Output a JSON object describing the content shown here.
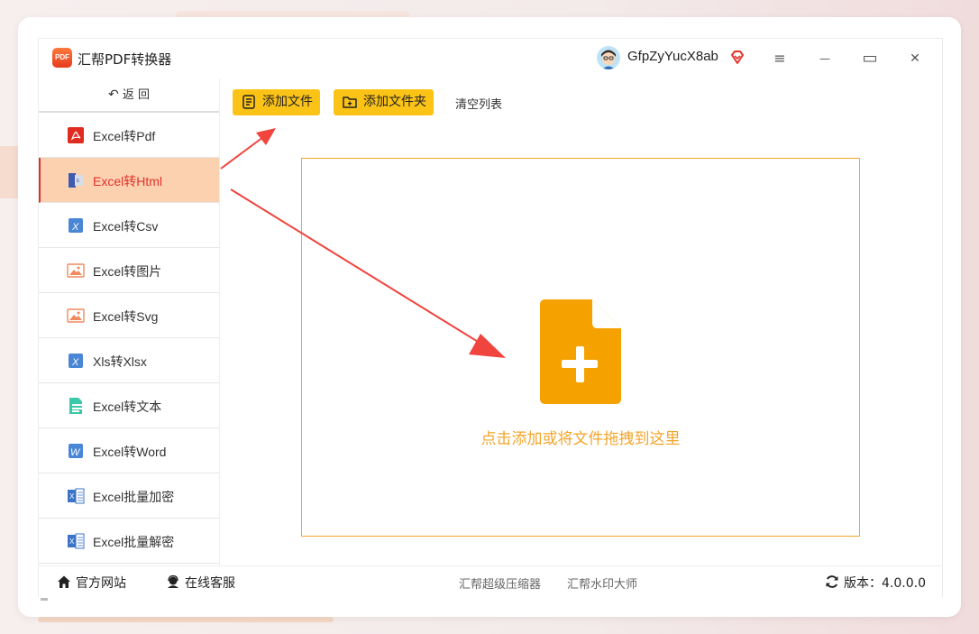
{
  "app": {
    "logo_text": "PDF",
    "title": "汇帮PDF转换器"
  },
  "user": {
    "name": "GfpZyYucX8ab"
  },
  "window_controls": {
    "menu": "≡",
    "minimize": "—",
    "maximize": "▭",
    "close": "✕"
  },
  "sidebar": {
    "back_label": "返 回",
    "items": [
      {
        "label": "Excel转Pdf",
        "icon": "pdf-icon",
        "active": false
      },
      {
        "label": "Excel转Html",
        "icon": "html-file-icon",
        "active": true
      },
      {
        "label": "Excel转Csv",
        "icon": "csv-icon",
        "active": false
      },
      {
        "label": "Excel转图片",
        "icon": "image-icon",
        "active": false
      },
      {
        "label": "Excel转Svg",
        "icon": "image-icon",
        "active": false
      },
      {
        "label": "Xls转Xlsx",
        "icon": "excel-x-icon",
        "active": false
      },
      {
        "label": "Excel转文本",
        "icon": "text-file-icon",
        "active": false
      },
      {
        "label": "Excel转Word",
        "icon": "word-icon",
        "active": false
      },
      {
        "label": "Excel批量加密",
        "icon": "excel-sheet-icon",
        "active": false
      },
      {
        "label": "Excel批量解密",
        "icon": "excel-sheet-icon",
        "active": false
      }
    ]
  },
  "toolbar": {
    "add_file": "添加文件",
    "add_folder": "添加文件夹",
    "clear_list": "清空列表"
  },
  "dropzone": {
    "text": "点击添加或将文件拖拽到这里"
  },
  "footer": {
    "website": "官方网站",
    "support": "在线客服",
    "link_compressor": "汇帮超级压缩器",
    "link_watermark": "汇帮水印大师",
    "version": "版本：4.0.0.0"
  },
  "colors": {
    "accent": "#fcc317",
    "active_bg": "#fcd1b0",
    "active_text": "#e0322c",
    "drop_border": "#f2a62a",
    "arrow": "#f0443e"
  }
}
